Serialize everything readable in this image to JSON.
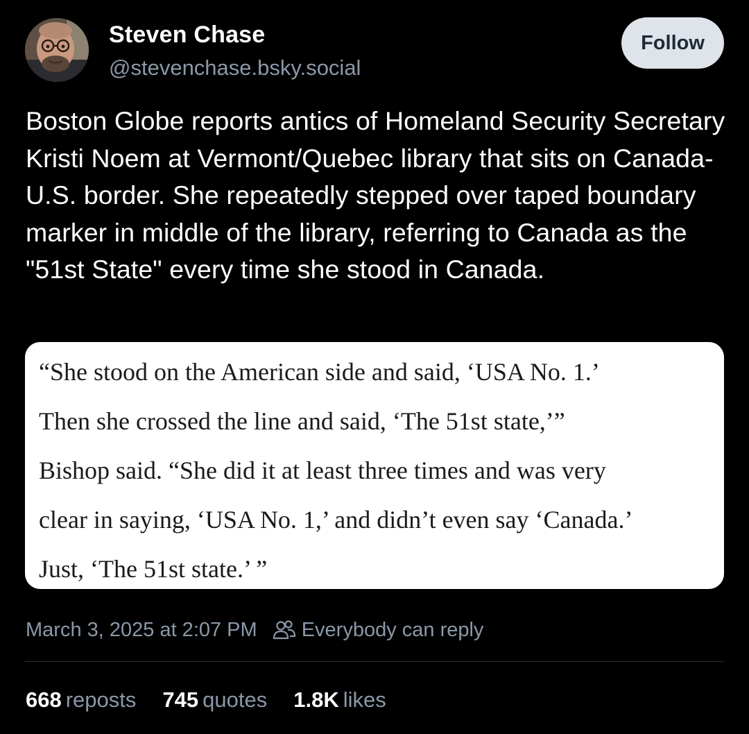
{
  "author": {
    "display_name": "Steven Chase",
    "handle": "@stevenchase.bsky.social",
    "avatar_icon": "user-avatar"
  },
  "follow_label": "Follow",
  "post_text": "Boston Globe reports antics of Homeland Security Secretary Kristi Noem at Vermont/Quebec library that sits on Canada-U.S. border. She repeatedly stepped over taped boundary marker in middle of the library, referring to Canada as the \"51st State\" every time she stood in Canada.",
  "quote_image": {
    "lines": [
      "“She stood on the American side and said, ‘USA No. 1.’",
      "Then she crossed the line and said, ‘The 51st state,’”",
      "Bishop said. “She did it at least three times and was very",
      "clear in saying, ‘USA No. 1,’ and didn’t even say ‘Canada.’",
      "Just, ‘The 51st state.’ ”"
    ]
  },
  "meta": {
    "timestamp": "March 3, 2025 at 2:07 PM",
    "reply_setting": "Everybody can reply",
    "reply_icon": "people-icon"
  },
  "stats": {
    "reposts": {
      "count": "668",
      "label": "reposts"
    },
    "quotes": {
      "count": "745",
      "label": "quotes"
    },
    "likes": {
      "count": "1.8K",
      "label": "likes"
    }
  },
  "colors": {
    "background": "#000000",
    "muted_text": "#8b98a8",
    "follow_button_bg": "#dfe4ea",
    "follow_button_text": "#1f2a36"
  }
}
